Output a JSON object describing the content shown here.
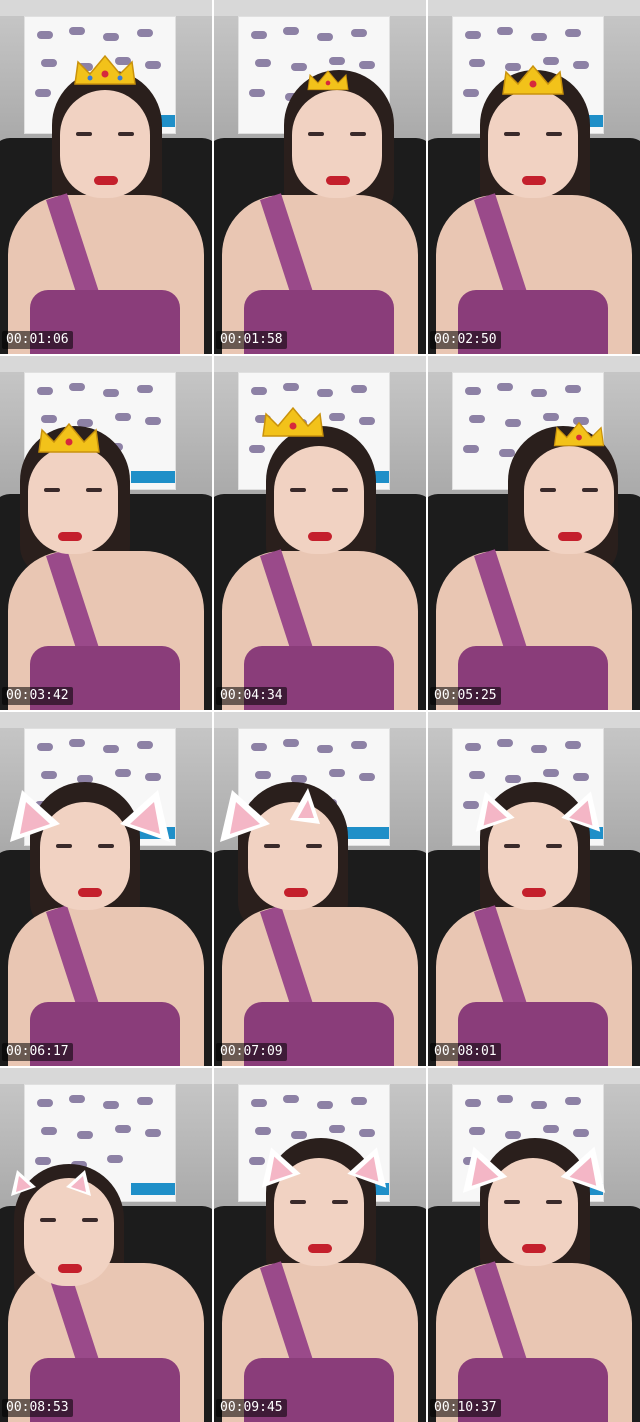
{
  "frames": [
    {
      "timestamp": "00:01:06",
      "overlay": "crown-icon"
    },
    {
      "timestamp": "00:01:58",
      "overlay": "crown-icon"
    },
    {
      "timestamp": "00:02:50",
      "overlay": "crown-icon"
    },
    {
      "timestamp": "00:03:42",
      "overlay": "crown-icon"
    },
    {
      "timestamp": "00:04:34",
      "overlay": "crown-icon"
    },
    {
      "timestamp": "00:05:25",
      "overlay": "crown-icon"
    },
    {
      "timestamp": "00:06:17",
      "overlay": "cat-ears-icon"
    },
    {
      "timestamp": "00:07:09",
      "overlay": "cat-ears-icon"
    },
    {
      "timestamp": "00:08:01",
      "overlay": "cat-ears-icon"
    },
    {
      "timestamp": "00:08:53",
      "overlay": "cat-ears-icon"
    },
    {
      "timestamp": "00:09:45",
      "overlay": "cat-ears-icon"
    },
    {
      "timestamp": "00:10:37",
      "overlay": "cat-ears-icon"
    }
  ],
  "colors": {
    "crown": "#f2c21a",
    "ear_outer": "#ffffff",
    "ear_inner": "#f4b6c6",
    "timestamp_bg": "#000000",
    "timestamp_text": "#ffffff"
  }
}
